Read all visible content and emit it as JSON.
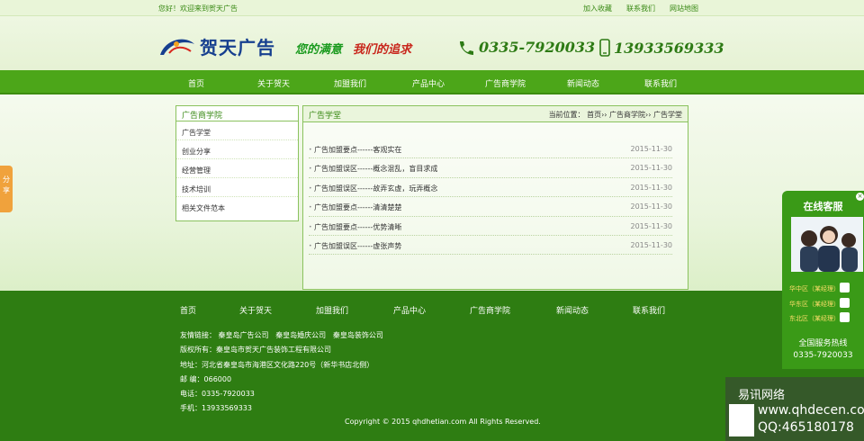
{
  "topbar": {
    "welcome": "您好！欢迎来到贺天广告",
    "links": [
      "加入收藏",
      "联系我们",
      "网站地图"
    ]
  },
  "header": {
    "logo_text": "贺天广告",
    "slogan_1": "您的满意",
    "slogan_2": "我们的追求",
    "phone": "0335-7920033",
    "mobile": "13933569333"
  },
  "nav": {
    "items": [
      "首页",
      "关于贺天",
      "加盟我们",
      "产品中心",
      "广告商学院",
      "新闻动态",
      "联系我们"
    ]
  },
  "sidebar": {
    "title": "广告商学院",
    "items": [
      "广告学堂",
      "创业分享",
      "经营管理",
      "技术培训",
      "相关文件范本"
    ]
  },
  "content": {
    "title": "广告学堂",
    "breadcrumb": "当前位置： 首页›› 广告商学院›› 广告学堂",
    "articles": [
      {
        "title": "广告加盟要点------客观实在",
        "date": "2015-11-30"
      },
      {
        "title": "广告加盟误区------概念混乱，盲目求成",
        "date": "2015-11-30"
      },
      {
        "title": "广告加盟误区------故弄玄虚，玩弄概念",
        "date": "2015-11-30"
      },
      {
        "title": "广告加盟要点------清清楚楚",
        "date": "2015-11-30"
      },
      {
        "title": "广告加盟要点------优势清晰",
        "date": "2015-11-30"
      },
      {
        "title": "广告加盟误区------虚张声势",
        "date": "2015-11-30"
      }
    ]
  },
  "footer": {
    "nav": [
      "首页",
      "关于贺天",
      "加盟我们",
      "产品中心",
      "广告商学院",
      "新闻动态",
      "联系我们"
    ],
    "links_label": "友情链接：",
    "links": [
      "秦皇岛广告公司",
      "秦皇岛婚庆公司",
      "秦皇岛装饰公司"
    ],
    "copyright_owner": "版权所有：秦皇岛市贺天广告装饰工程有限公司",
    "address": "地址：河北省秦皇岛市海港区文化路220号（新华书店北侧）",
    "postcode": "邮 编：066000",
    "tel": "电话：0335-7920033",
    "mobile": "手机：13933569333",
    "copyright": "Copyright © 2015 qhdhetian.com All Rights Reserved."
  },
  "share": {
    "label": "分享"
  },
  "service": {
    "title": "在线客服",
    "items": [
      "华中区（某经理）",
      "华东区（某经理）",
      "东北区（某经理）"
    ],
    "hotline_label": "全国服务热线",
    "hotline": "0335-7920033"
  },
  "watermark": {
    "name": "易讯网络",
    "url": "www.qhdecen.com",
    "qq": "QQ:465180178"
  },
  "colors": {
    "nav_green": "#4ca619",
    "footer_green": "#2e7d12",
    "accent_text": "#3a8a16",
    "share_orange": "#f0a23c"
  }
}
